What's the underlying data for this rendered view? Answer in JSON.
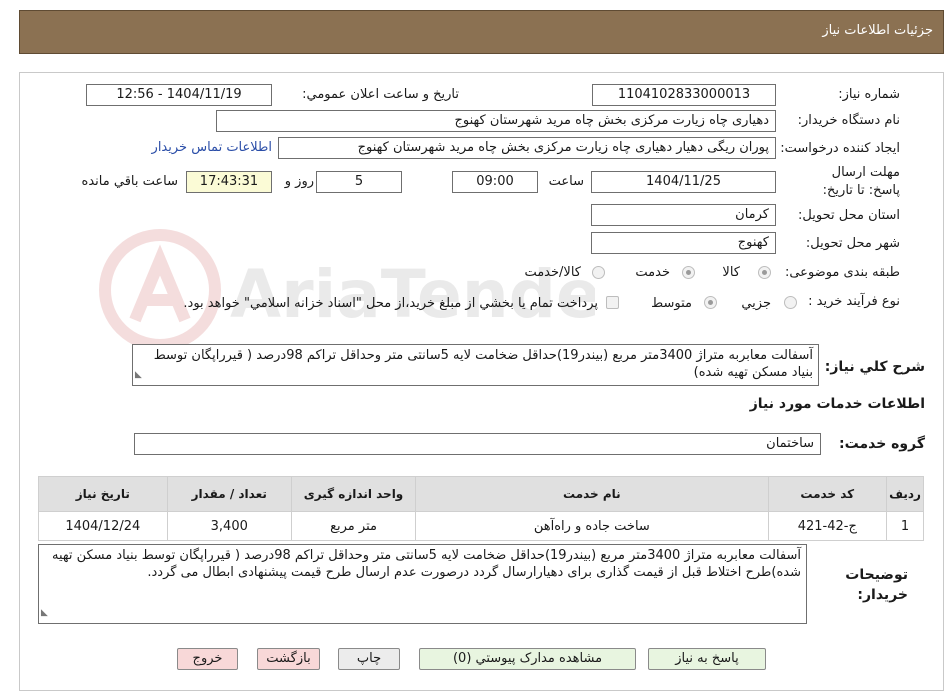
{
  "header": {
    "title": "جزئیات اطلاعات نیاز"
  },
  "form": {
    "need_number_label": "شماره نیاز:",
    "need_number": "1104102833000013",
    "announce_label": "تاریخ و ساعت اعلان عمومي:",
    "announce_value": "1404/11/19 - 12:56",
    "buyer_org_label": "نام دستگاه خريدار:",
    "buyer_org": "دهیاری چاه زیارت مرکزی بخش چاه مرید شهرستان کهنوج",
    "requester_label": "ايجاد کننده درخواست:",
    "requester": "پوران ریگی دهیار دهیاری چاه زیارت مرکزی بخش چاه مرید شهرستان کهنوج",
    "contact_link": "اطلاعات تماس خريدار",
    "deadline_label": "مهلت ارسال پاسخ: تا تاريخ:",
    "deadline_date": "1404/11/25",
    "hour_label": "ساعت",
    "deadline_time": "09:00",
    "days": "5",
    "days_label": "روز و",
    "remaining_time": "17:43:31",
    "remaining_label": "ساعت باقي مانده",
    "province_label": "استان محل تحويل:",
    "province": "کرمان",
    "city_label": "شهر محل تحويل:",
    "city": "کهنوج",
    "category_label": "طبقه بندی موضوعی:",
    "category_options": [
      "کالا",
      "خدمت",
      "کالا/خدمت"
    ],
    "process_label": "نوع فرآیند خرید :",
    "process_options": [
      "جزيي",
      "متوسط"
    ],
    "payment_note": "پرداخت تمام يا بخشي از مبلغ خريد،از محل \"اسناد خزانه اسلامي\" خواهد بود.",
    "summary_label": "شرح کلي نياز:",
    "summary": "آسفالت معابربه متراژ 3400متر مربع (بیندر19)حداقل ضخامت لایه 5سانتی متر وحداقل تراکم 98درصد ( قیرراپگان توسط بنیاد مسکن تهیه شده)",
    "services_title": "اطلاعات خدمات مورد نياز",
    "service_group_label": "گروه خدمت:",
    "service_group": "ساختمان"
  },
  "table": {
    "headers": [
      "رديف",
      "کد خدمت",
      "نام خدمت",
      "واحد اندازه گيری",
      "تعداد / مقدار",
      "تاريخ نياز"
    ],
    "rows": [
      [
        "1",
        "ج-42-421",
        "ساخت جاده و راه‌آهن",
        "متر مربع",
        "3,400",
        "1404/12/24"
      ]
    ]
  },
  "buyer_notes": {
    "label": "توضيحات خريدار:",
    "text": "آسفالت معابربه متراژ 3400متر مربع (بیندر19)حداقل ضخامت لایه 5سانتی متر وحداقل تراکم 98درصد ( قیرراپگان توسط بنیاد مسکن تهیه شده)طرح اختلاط قبل از قیمت گذاری برای دهیارارسال گردد درصورت عدم ارسال طرح قیمت پیشنهادی ابطال می گردد."
  },
  "buttons": {
    "reply": "پاسخ به نياز",
    "attachments": "مشاهده مدارک پيوستي (0)",
    "print": "چاپ",
    "back": "بازگشت",
    "exit": "خروج"
  },
  "watermark": "AriaTender.neT",
  "colors": {
    "header": "#8b7152",
    "link": "#2b4ea8",
    "highlight": "#fbfbd6"
  }
}
